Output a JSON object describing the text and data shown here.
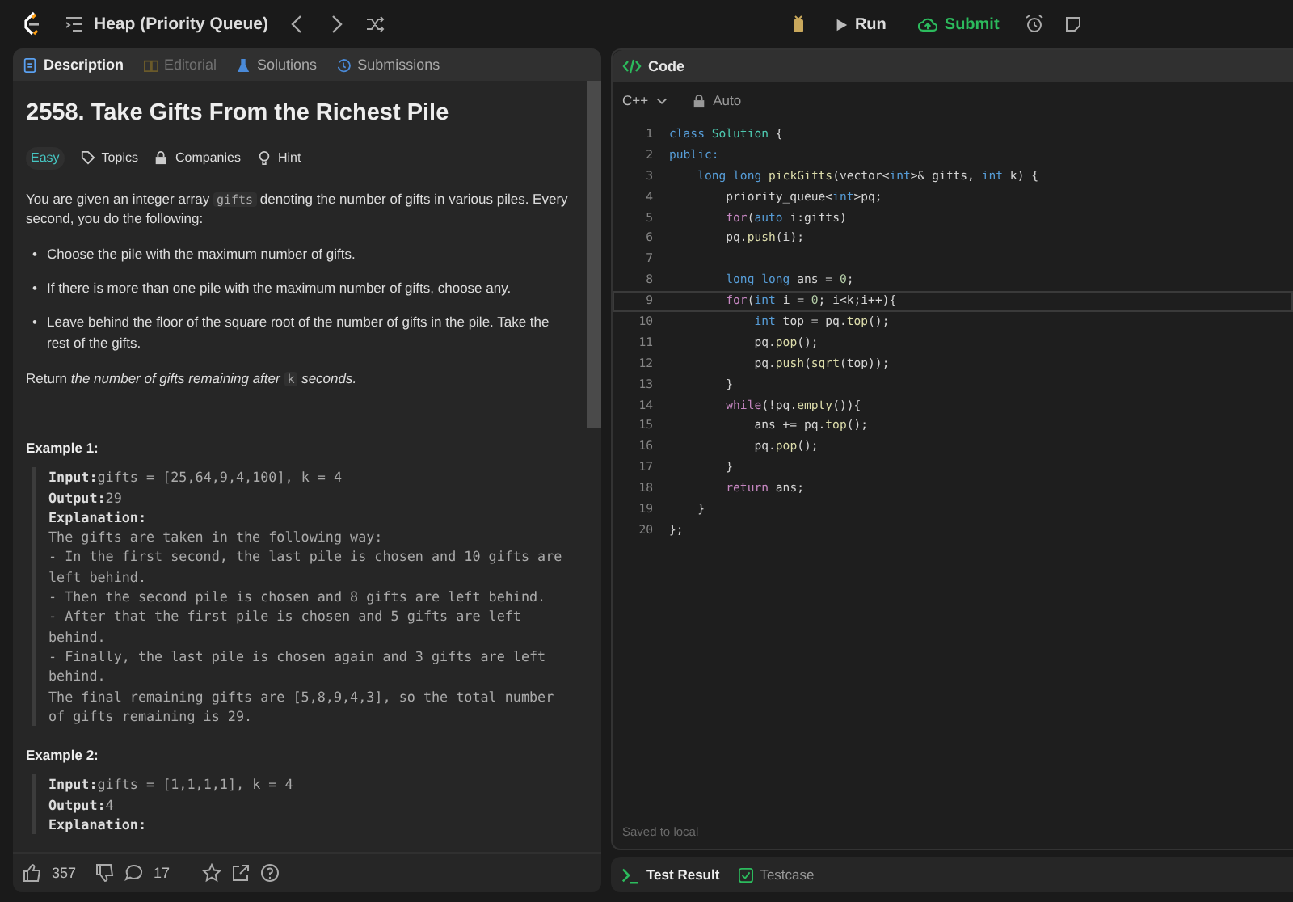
{
  "topbar": {
    "list_title": "Heap (Priority Queue)",
    "run": "Run",
    "submit": "Submit"
  },
  "left_tabs": [
    {
      "label": "Description",
      "selected": true,
      "disabled": false
    },
    {
      "label": "Editorial",
      "selected": false,
      "disabled": true
    },
    {
      "label": "Solutions",
      "selected": false,
      "disabled": false
    },
    {
      "label": "Submissions",
      "selected": false,
      "disabled": false
    }
  ],
  "problem": {
    "title": "2558. Take Gifts From the Richest Pile",
    "difficulty": "Easy",
    "tags": [
      "Topics",
      "Companies",
      "Hint"
    ],
    "paragraphs": [
      [
        {
          "kind": "text",
          "text": "You are given an integer array "
        },
        {
          "kind": "code",
          "text": "gifts"
        },
        {
          "kind": "text",
          "text": " denoting the number of gifts in various piles. Every second, you do the following:"
        }
      ]
    ],
    "bullets": [
      {
        "marker": "•",
        "text": "Choose the pile with the maximum number of gifts."
      },
      {
        "marker": "•",
        "text": "If there is more than one pile with the maximum number of gifts, choose any."
      },
      {
        "marker": "•",
        "text": "Leave behind the floor of the square root of the number of gifts in the pile. Take the rest of the gifts."
      }
    ],
    "return_line": [
      {
        "kind": "text",
        "text": "Return "
      },
      {
        "kind": "italic",
        "text": "the number of gifts remaining after "
      },
      {
        "kind": "code",
        "text": "k"
      },
      {
        "kind": "italic",
        "text": " seconds."
      }
    ],
    "examples": [
      {
        "title": "Example 1:",
        "lines": [
          {
            "label": "Input:",
            "text": "gifts = [25,64,9,4,100], k = 4"
          },
          {
            "label": "Output:",
            "text": "29"
          },
          {
            "label": "Explanation:"
          },
          {
            "text": "The gifts are taken in the following way:"
          },
          {
            "text": "- In the first second, the last pile is chosen and 10 gifts are left behind."
          },
          {
            "text": "- Then the second pile is chosen and 8 gifts are left behind."
          },
          {
            "text": "- After that the first pile is chosen and 5 gifts are left behind."
          },
          {
            "text": "- Finally, the last pile is chosen again and 3 gifts are left behind."
          },
          {
            "text": "The final remaining gifts are [5,8,9,4,3], so the total number of gifts remaining is 29."
          }
        ]
      },
      {
        "title": "Example 2:",
        "lines": [
          {
            "label": "Input:",
            "text": "gifts = [1,1,1,1], k = 4"
          },
          {
            "label": "Output:",
            "text": "4"
          },
          {
            "label": "Explanation:"
          }
        ]
      }
    ]
  },
  "left_footer": {
    "likes": "357",
    "comments": "17"
  },
  "code_panel": {
    "title": "Code",
    "language": "C++",
    "mode": "Auto",
    "saved": "Saved to local",
    "lines": [
      {
        "n": "1",
        "current": false,
        "tokens": [
          {
            "kind": "kw",
            "text": "class "
          },
          {
            "kind": "type",
            "text": "Solution"
          },
          {
            "kind": "plain",
            "text": " {"
          }
        ]
      },
      {
        "n": "2",
        "current": false,
        "tokens": [
          {
            "kind": "kw",
            "text": "public:"
          }
        ]
      },
      {
        "n": "3",
        "current": false,
        "tokens": [
          {
            "kind": "kw",
            "text": "    long long "
          },
          {
            "kind": "fn",
            "text": "pickGifts"
          },
          {
            "kind": "plain",
            "text": "(vector<"
          },
          {
            "kind": "kw",
            "text": "int"
          },
          {
            "kind": "plain",
            "text": ">& gifts, "
          },
          {
            "kind": "kw",
            "text": "int"
          },
          {
            "kind": "plain",
            "text": " k) {"
          }
        ]
      },
      {
        "n": "4",
        "current": false,
        "tokens": [
          {
            "kind": "plain",
            "text": "        priority_queue<"
          },
          {
            "kind": "kw",
            "text": "int"
          },
          {
            "kind": "plain",
            "text": ">pq;"
          }
        ]
      },
      {
        "n": "5",
        "current": false,
        "tokens": [
          {
            "kind": "ctrl",
            "text": "        for"
          },
          {
            "kind": "plain",
            "text": "("
          },
          {
            "kind": "kw",
            "text": "auto"
          },
          {
            "kind": "plain",
            "text": " i:gifts)"
          }
        ]
      },
      {
        "n": "6",
        "current": false,
        "tokens": [
          {
            "kind": "plain",
            "text": "        pq."
          },
          {
            "kind": "fn",
            "text": "push"
          },
          {
            "kind": "plain",
            "text": "(i);"
          }
        ]
      },
      {
        "n": "7",
        "current": false
      },
      {
        "n": "8",
        "current": false,
        "tokens": [
          {
            "kind": "kw",
            "text": "        long long"
          },
          {
            "kind": "plain",
            "text": " ans = "
          },
          {
            "kind": "num",
            "text": "0"
          },
          {
            "kind": "plain",
            "text": ";"
          }
        ]
      },
      {
        "n": "9",
        "current": true,
        "tokens": [
          {
            "kind": "ctrl",
            "text": "        for"
          },
          {
            "kind": "plain",
            "text": "("
          },
          {
            "kind": "kw",
            "text": "int"
          },
          {
            "kind": "plain",
            "text": " i = "
          },
          {
            "kind": "num",
            "text": "0"
          },
          {
            "kind": "plain",
            "text": "; i<k;i++){"
          }
        ]
      },
      {
        "n": "10",
        "current": false,
        "tokens": [
          {
            "kind": "kw",
            "text": "            int"
          },
          {
            "kind": "plain",
            "text": " top = pq."
          },
          {
            "kind": "fn",
            "text": "top"
          },
          {
            "kind": "plain",
            "text": "();"
          }
        ]
      },
      {
        "n": "11",
        "current": false,
        "tokens": [
          {
            "kind": "plain",
            "text": "            pq."
          },
          {
            "kind": "fn",
            "text": "pop"
          },
          {
            "kind": "plain",
            "text": "();"
          }
        ]
      },
      {
        "n": "12",
        "current": false,
        "tokens": [
          {
            "kind": "plain",
            "text": "            pq."
          },
          {
            "kind": "fn",
            "text": "push"
          },
          {
            "kind": "plain",
            "text": "("
          },
          {
            "kind": "fn",
            "text": "sqrt"
          },
          {
            "kind": "plain",
            "text": "(top));"
          }
        ]
      },
      {
        "n": "13",
        "current": false,
        "tokens": [
          {
            "kind": "plain",
            "text": "        }"
          }
        ]
      },
      {
        "n": "14",
        "current": false,
        "tokens": [
          {
            "kind": "ctrl",
            "text": "        while"
          },
          {
            "kind": "plain",
            "text": "(!pq."
          },
          {
            "kind": "fn",
            "text": "empty"
          },
          {
            "kind": "plain",
            "text": "()){"
          }
        ]
      },
      {
        "n": "15",
        "current": false,
        "tokens": [
          {
            "kind": "plain",
            "text": "            ans += pq."
          },
          {
            "kind": "fn",
            "text": "top"
          },
          {
            "kind": "plain",
            "text": "();"
          }
        ]
      },
      {
        "n": "16",
        "current": false,
        "tokens": [
          {
            "kind": "plain",
            "text": "            pq."
          },
          {
            "kind": "fn",
            "text": "pop"
          },
          {
            "kind": "plain",
            "text": "();"
          }
        ]
      },
      {
        "n": "17",
        "current": false,
        "tokens": [
          {
            "kind": "plain",
            "text": "        }"
          }
        ]
      },
      {
        "n": "18",
        "current": false,
        "tokens": [
          {
            "kind": "ctrl",
            "text": "        return"
          },
          {
            "kind": "plain",
            "text": " ans;"
          }
        ]
      },
      {
        "n": "19",
        "current": false,
        "tokens": [
          {
            "kind": "plain",
            "text": "    }"
          }
        ]
      },
      {
        "n": "20",
        "current": false,
        "tokens": [
          {
            "kind": "plain",
            "text": "};"
          }
        ]
      }
    ]
  },
  "bottom_tabs": [
    {
      "label": "Test Result",
      "selected": true
    },
    {
      "label": "Testcase",
      "selected": false
    }
  ]
}
